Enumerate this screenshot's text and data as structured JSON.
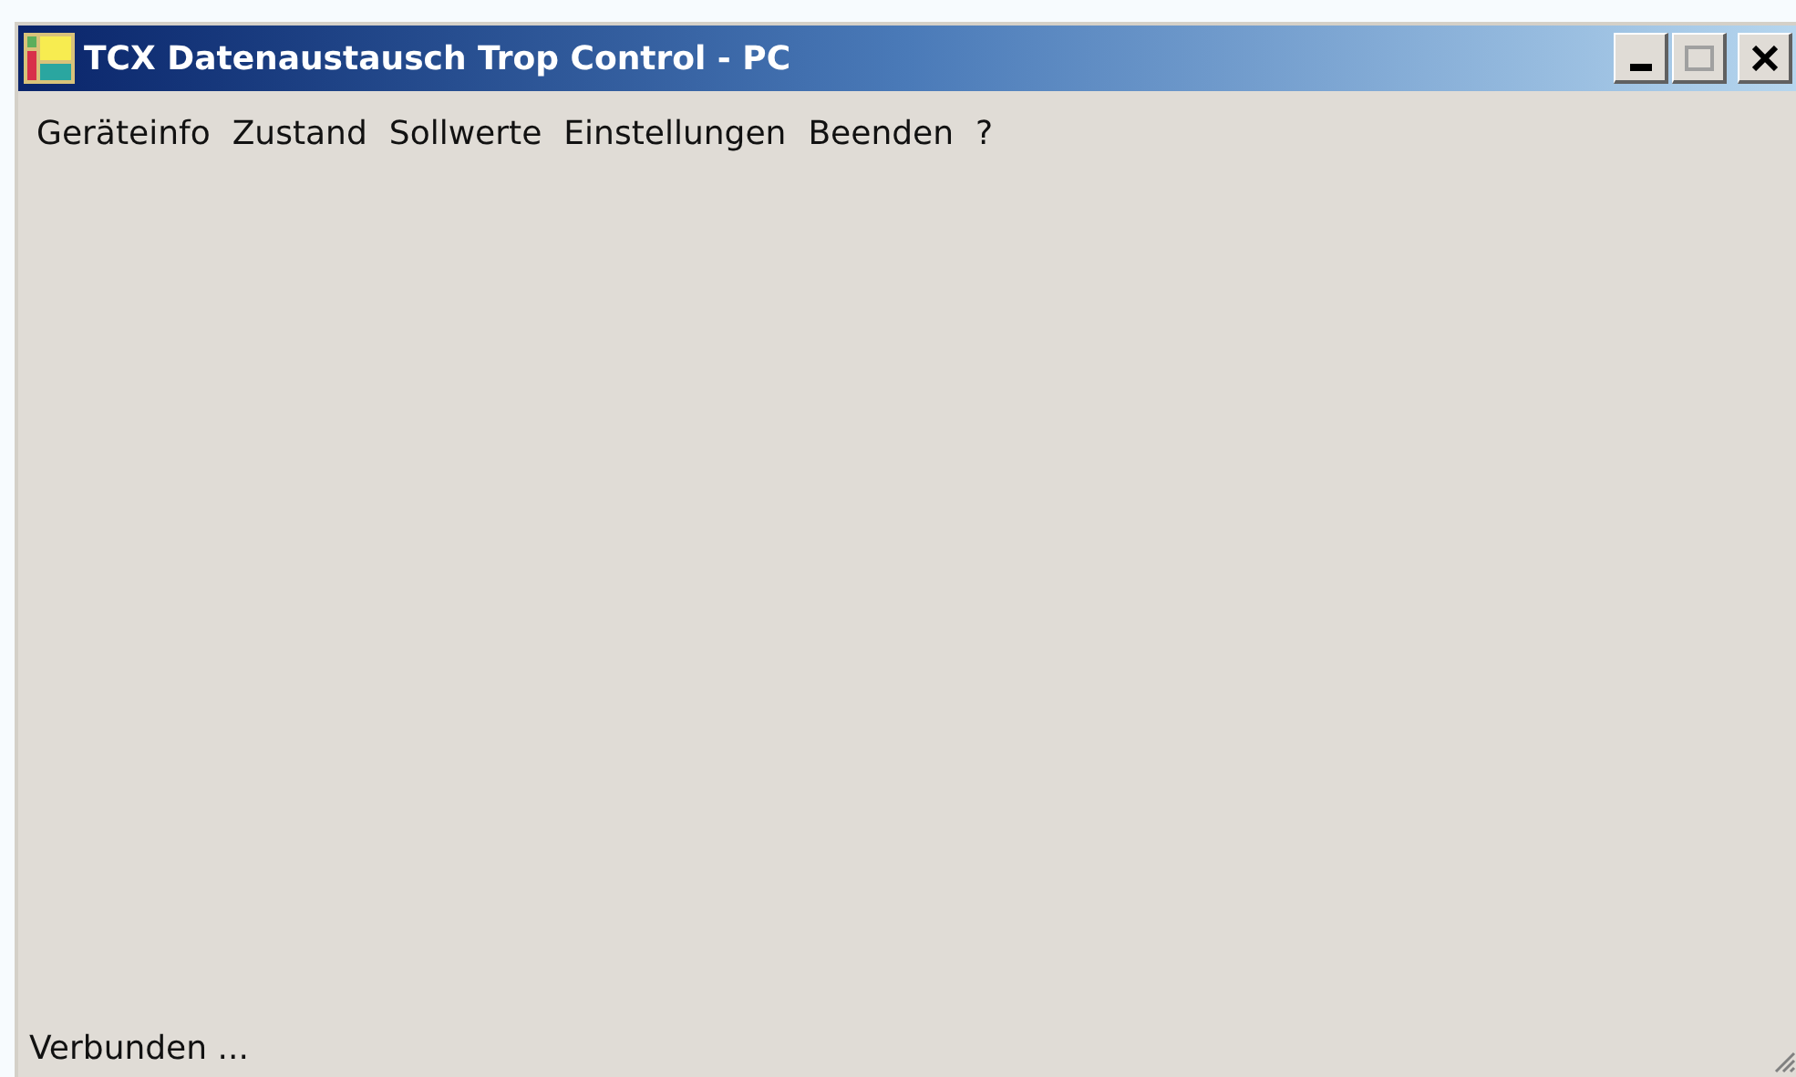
{
  "window": {
    "title": "TCX Datenaustausch Trop Control - PC"
  },
  "menu": [
    {
      "label": "Geräteinfo"
    },
    {
      "label": "Zustand"
    },
    {
      "label": "Sollwerte"
    },
    {
      "label": "Einstellungen"
    },
    {
      "label": "Beenden"
    },
    {
      "label": "?"
    }
  ],
  "status_bar": {
    "text": "Verbunden ..."
  }
}
